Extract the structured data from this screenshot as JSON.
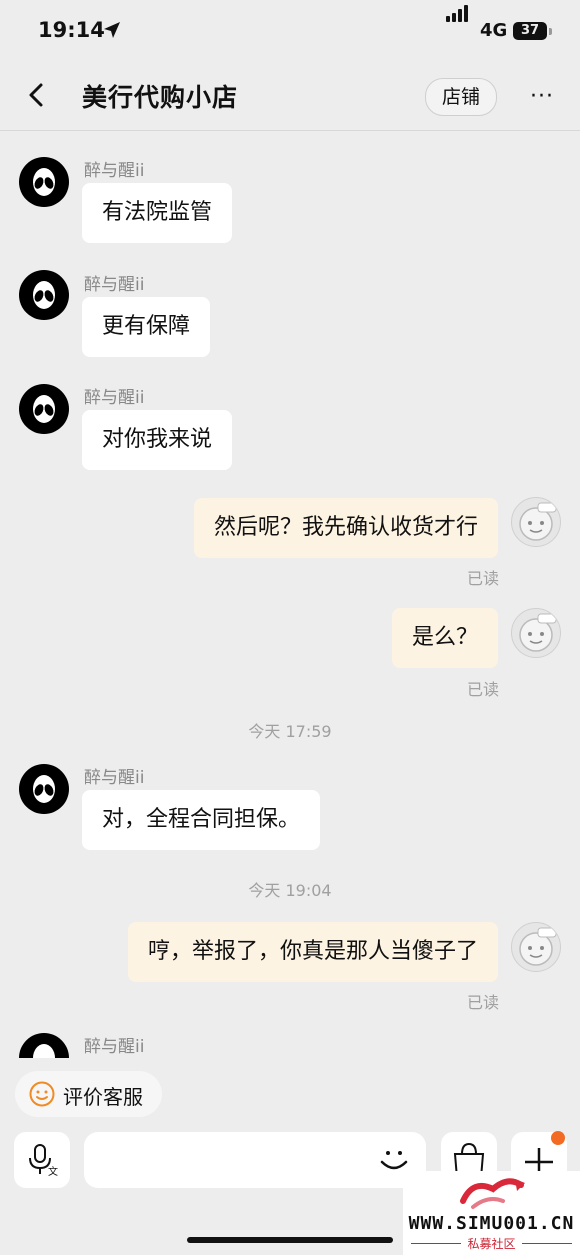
{
  "status_bar": {
    "time": "19:14",
    "network": "4G",
    "battery": "37"
  },
  "header": {
    "title": "美行代购小店",
    "shop_button": "店铺",
    "more": "···"
  },
  "messages": [
    {
      "sender": "醉与醒ii",
      "text": "有法院监管"
    },
    {
      "sender": "醉与醒ii",
      "text": "更有保障"
    },
    {
      "sender": "醉与醒ii",
      "text": "对你我来说"
    },
    {
      "text": "然后呢？我先确认收货才行",
      "status": "已读"
    },
    {
      "text": "是么？",
      "status": "已读"
    },
    {
      "sender": "醉与醒ii",
      "text": "对，全程合同担保。"
    },
    {
      "text": "哼，举报了，你真是那人当傻子了",
      "status": "已读"
    },
    {
      "sender": "醉与醒ii"
    }
  ],
  "timestamps": [
    "今天 17:59",
    "今天 19:04"
  ],
  "rate_chip": {
    "label": "评价客服"
  },
  "input": {
    "value": ""
  },
  "watermark": {
    "site": "WWW.SIMU001.CN",
    "sub": "私募社区"
  },
  "colors": {
    "incoming_bubble": "#ffffff",
    "outgoing_bubble": "#fdf3e2",
    "badge_dot": "#f36a24",
    "background": "#ededed"
  },
  "icons": {
    "back": "chevron-left-icon",
    "location": "location-arrow-icon",
    "voice": "microphone-translate-icon",
    "emoji": "smiley-icon",
    "bag": "shopping-bag-icon",
    "plus": "plus-icon",
    "rate": "smiley-face-orange-icon"
  }
}
